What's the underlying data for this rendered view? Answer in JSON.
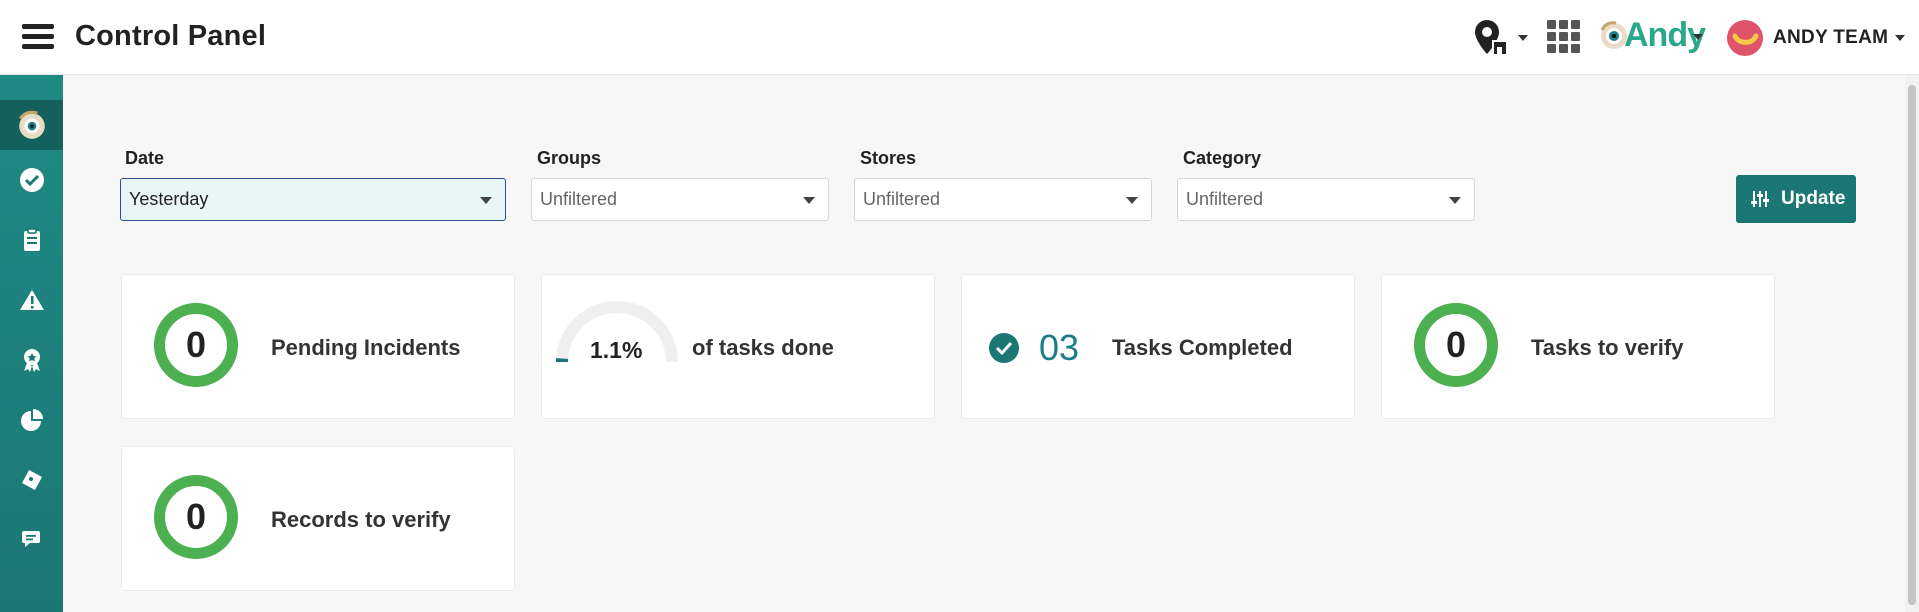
{
  "header": {
    "title": "Control Panel",
    "brand_name": "Andy",
    "user_name": "ANDY TEAM"
  },
  "sidebar": {
    "items": [
      {
        "icon": "logo-eye-icon",
        "active": true
      },
      {
        "icon": "check-circle-icon"
      },
      {
        "icon": "clipboard-icon"
      },
      {
        "icon": "warning-icon"
      },
      {
        "icon": "award-icon"
      },
      {
        "icon": "pie-chart-icon"
      },
      {
        "icon": "ticket-icon"
      },
      {
        "icon": "chat-icon"
      }
    ]
  },
  "filters": {
    "date": {
      "label": "Date",
      "value": "Yesterday"
    },
    "groups": {
      "label": "Groups",
      "value": "Unfiltered"
    },
    "stores": {
      "label": "Stores",
      "value": "Unfiltered"
    },
    "category": {
      "label": "Category",
      "value": "Unfiltered"
    },
    "update_label": "Update"
  },
  "cards": {
    "pending_incidents": {
      "value": "0",
      "label": "Pending Incidents"
    },
    "tasks_done": {
      "value": "1.1%",
      "percent": 1.1,
      "label": "of tasks done"
    },
    "tasks_completed": {
      "value": "03",
      "label": "Tasks Completed"
    },
    "tasks_to_verify": {
      "value": "0",
      "label": "Tasks to verify"
    },
    "records_to_verify": {
      "value": "0",
      "label": "Records to verify"
    }
  },
  "colors": {
    "primary": "#1b7773",
    "ring": "#4caf50",
    "accent_text": "#1b7d85",
    "brand": "#2aa889"
  }
}
